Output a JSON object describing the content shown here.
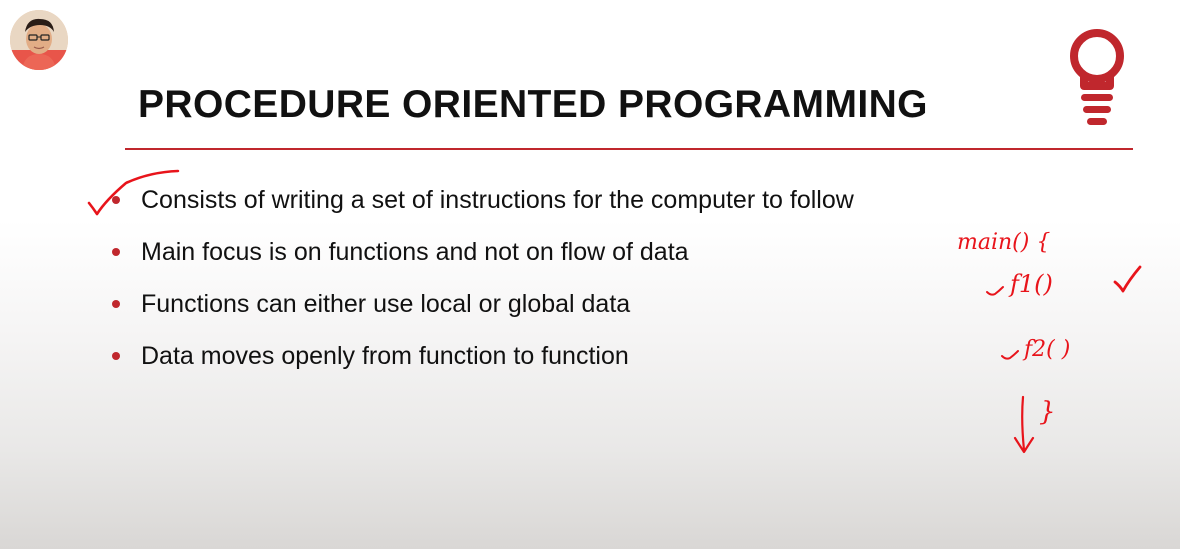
{
  "slide": {
    "title": "PROCEDURE ORIENTED PROGRAMMING",
    "bullets": [
      "Consists of writing a set of instructions for the computer to follow",
      "Main focus is on functions and not on flow of data",
      "Functions can either use local or global data",
      "Data moves openly from function to function"
    ]
  },
  "handwriting": {
    "main_label": "main() {",
    "f1_label": "f1()",
    "f2_label": "f2( )",
    "close_brace": "}"
  },
  "colors": {
    "accent": "#c0272d",
    "ink": "#e8141b",
    "text": "#111111"
  },
  "icons": {
    "bulb": "lightbulb-icon",
    "avatar": "presenter-avatar"
  }
}
